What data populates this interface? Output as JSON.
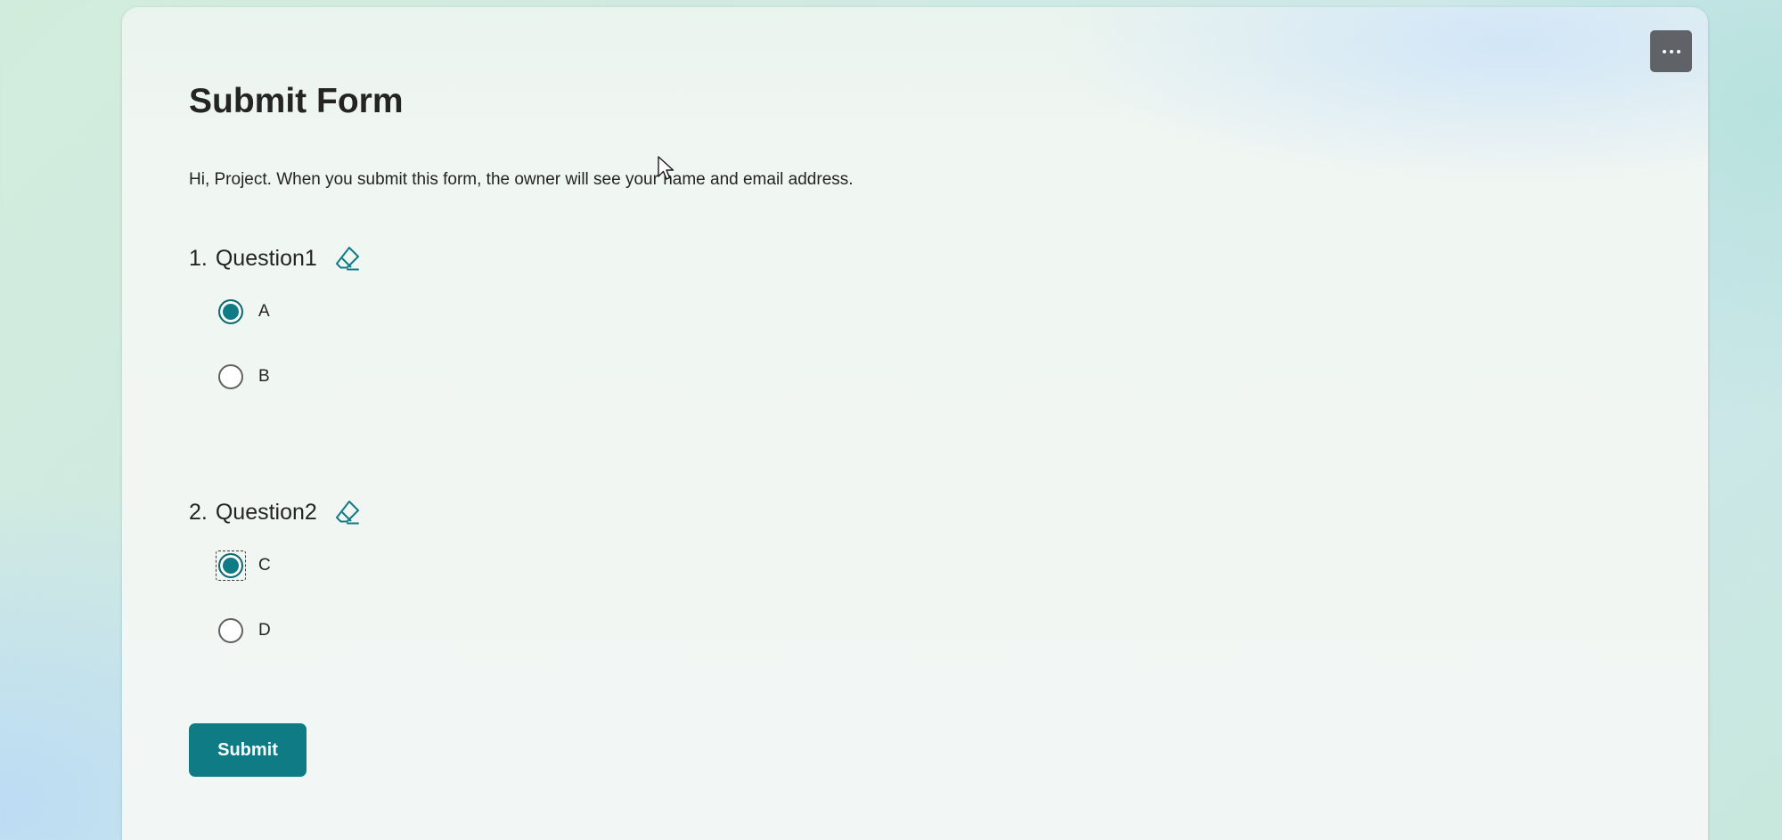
{
  "form": {
    "title": "Submit Form",
    "intro": "Hi, Project. When you submit this form, the owner will see your name and email address.",
    "submit_label": "Submit",
    "more_options_icon": "more-horizontal-icon"
  },
  "questions": [
    {
      "number": "1.",
      "title": "Question1",
      "clear_icon": "eraser-icon",
      "options": [
        {
          "label": "A",
          "selected": true
        },
        {
          "label": "B",
          "selected": false
        }
      ]
    },
    {
      "number": "2.",
      "title": "Question2",
      "clear_icon": "eraser-icon",
      "options": [
        {
          "label": "C",
          "selected": true
        },
        {
          "label": "D",
          "selected": false
        }
      ]
    }
  ],
  "colors": {
    "accent": "#0f7b84",
    "text": "#242424",
    "more_button": "#5f6368"
  }
}
